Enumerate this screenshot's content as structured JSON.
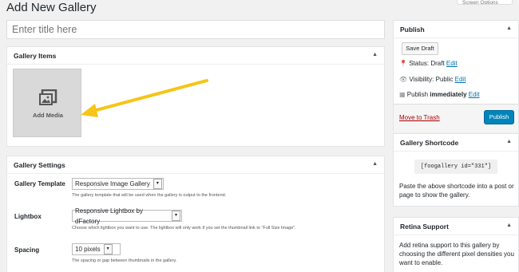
{
  "header": {
    "title": "Add New Gallery",
    "screen_options": "Screen Options"
  },
  "title_field": {
    "placeholder": "Enter title here"
  },
  "gallery_items": {
    "heading": "Gallery Items",
    "add_media_label": "Add Media"
  },
  "gallery_settings": {
    "heading": "Gallery Settings",
    "template": {
      "label": "Gallery Template",
      "value": "Responsive Image Gallery",
      "description": "The gallery template that will be used when the gallery is output to the frontend."
    },
    "lightbox": {
      "label": "Lightbox",
      "value": "Responsive Lightbox by dFactory",
      "description": "Choose which lightbox you want to use. The lightbox will only work if you set the thumbnail link to \"Full Size Image\"."
    },
    "spacing": {
      "label": "Spacing",
      "value": "10 pixels",
      "description": "The spacing or gap between thumbnails in the gallery."
    }
  },
  "publish": {
    "heading": "Publish",
    "save_draft": "Save Draft",
    "status_label": "Status:",
    "status_value": "Draft",
    "visibility_label": "Visibility:",
    "visibility_value": "Public",
    "publish_label": "Publish",
    "publish_value": "immediately",
    "edit": "Edit",
    "move_to_trash": "Move to Trash",
    "publish_button": "Publish"
  },
  "shortcode": {
    "heading": "Gallery Shortcode",
    "code": "[foogallery id=\"331\"]",
    "help": "Paste the above shortcode into a post or page to show the gallery."
  },
  "retina": {
    "heading": "Retina Support",
    "text": "Add retina support to this gallery by choosing the different pixel densities you want to enable."
  },
  "colors": {
    "arrow": "#f5c518",
    "primary": "#0085ba",
    "link": "#0073aa",
    "trash": "#a00"
  }
}
